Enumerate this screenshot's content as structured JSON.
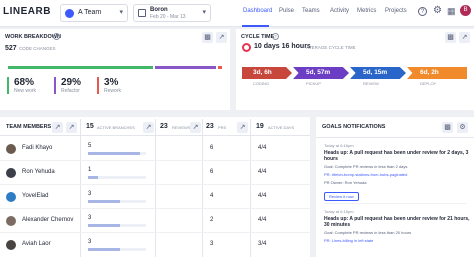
{
  "brand": {
    "name": "LINEARB"
  },
  "team_selector": {
    "label": "A Team"
  },
  "date_selector": {
    "title": "Boron",
    "range": "Feb 20 - Mar 13"
  },
  "nav": {
    "items": [
      "Dashboard",
      "Pulse",
      "Teams",
      "Activity",
      "Metrics",
      "Projects"
    ],
    "active": "Dashboard"
  },
  "user": {
    "initial": "B"
  },
  "colors": {
    "accent": "#3d5afe",
    "new_work": "#43b86b",
    "refactor": "#8a57c8",
    "rework": "#e8584f",
    "coding": "#c8473d",
    "pickup": "#6c3ec4",
    "review": "#2a66c9",
    "deploy": "#f08a2a"
  },
  "work_breakdown": {
    "title": "WORK BREAKDOWN",
    "count": "527",
    "count_label": "CODE CHANGES",
    "items": [
      {
        "pct": "68%",
        "label": "New work",
        "share": 0.68
      },
      {
        "pct": "29%",
        "label": "Refactor",
        "share": 0.29
      },
      {
        "pct": "3%",
        "label": "Rework",
        "share": 0.03
      }
    ]
  },
  "cycle_time": {
    "title": "CYCLE TIME",
    "value": "10 days 16 hours",
    "value_label": "AVERAGE CYCLE TIME",
    "stages": [
      {
        "value": "3d, 6h",
        "label": "CODING"
      },
      {
        "value": "5d, 57m",
        "label": "PICKUP"
      },
      {
        "value": "5d, 15m",
        "label": "REVIEW"
      },
      {
        "value": "6d, 2h",
        "label": "DEPLOY"
      }
    ]
  },
  "team_members": {
    "title": "TEAM MEMBERS",
    "columns": [
      {
        "num": "15",
        "label": "ACTIVE BRANCHES"
      },
      {
        "num": "23",
        "label": "REVIEWS"
      },
      {
        "num": "23",
        "label": "PRS"
      },
      {
        "num": "19",
        "label": "ACTIVE DAYS"
      }
    ],
    "rows": [
      {
        "name": "Fadi Khayo",
        "branches": "5",
        "branch_share": 0.9,
        "reviews": "",
        "prs": "6",
        "days": "4/4"
      },
      {
        "name": "Ron Yehuda",
        "branches": "1",
        "branch_share": 0.18,
        "reviews": "",
        "prs": "6",
        "days": "4/4"
      },
      {
        "name": "YovelElad",
        "branches": "3",
        "branch_share": 0.55,
        "reviews": "",
        "prs": "4",
        "days": "4/4"
      },
      {
        "name": "Alexander Chernov",
        "branches": "3",
        "branch_share": 0.55,
        "reviews": "",
        "prs": "2",
        "days": "4/4"
      },
      {
        "name": "Aviah Laor",
        "branches": "3",
        "branch_share": 0.55,
        "reviews": "",
        "prs": "3",
        "days": "3/4"
      }
    ]
  },
  "goals": {
    "title": "GOALS NOTIFICATIONS",
    "notifications": [
      {
        "time": "Today at 6:16pm",
        "headline": "Heads up: A pull request has been under review for 2 days, 3 hours",
        "goal": "Goal: Complete PR reviews in less than 2 days",
        "pr": "PR: #fetch-bump-stations-from-hubs-paginated",
        "owner": "PR Owner: Ron Yehuda",
        "action": "Review it now"
      },
      {
        "time": "Today at 6:16pm",
        "headline": "Heads up: A pull request has been under review for 21 hours, 30 minutes",
        "goal": "Goal: Complete PR reviews in less than 20 hours",
        "pr": "PR: Lines-billing in left state",
        "owner": "",
        "action": ""
      }
    ]
  }
}
